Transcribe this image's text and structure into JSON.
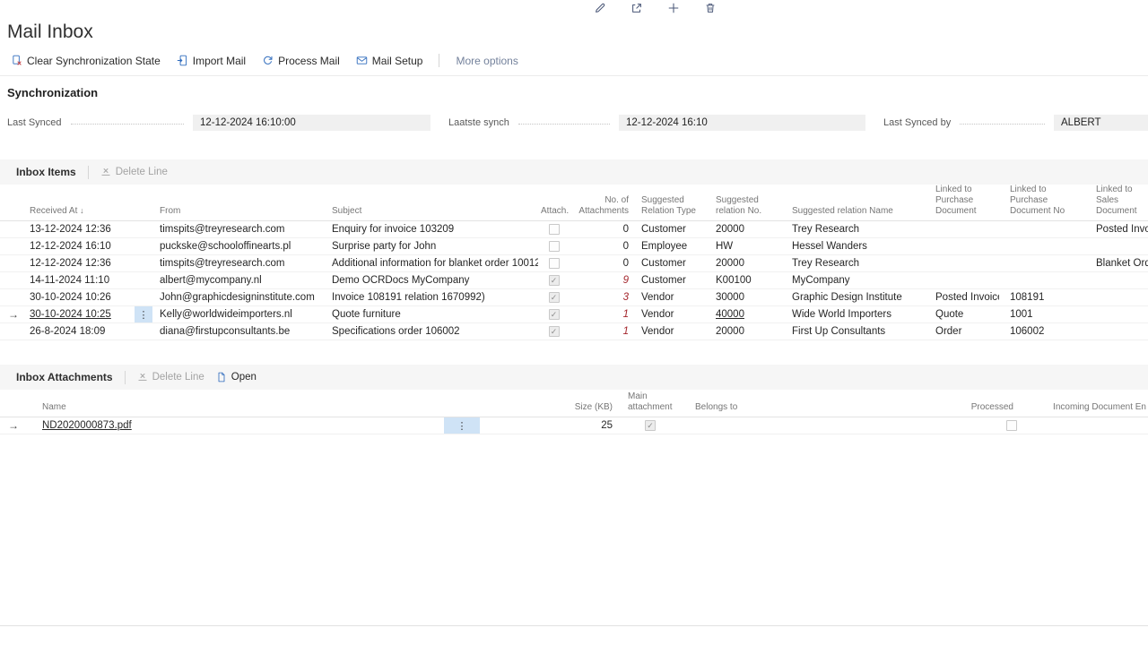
{
  "topbar": {
    "icons": [
      "edit-icon",
      "share-icon",
      "new-icon",
      "delete-icon"
    ]
  },
  "page": {
    "title": "Mail Inbox"
  },
  "action_bar": {
    "clear_sync": "Clear Synchronization State",
    "import_mail": "Import Mail",
    "process_mail": "Process Mail",
    "mail_setup": "Mail Setup",
    "more_options": "More options"
  },
  "synchronization": {
    "heading": "Synchronization",
    "fields": [
      {
        "label": "Last Synced",
        "value": "12-12-2024 16:10:00"
      },
      {
        "label": "Laatste synch",
        "value": "12-12-2024 16:10"
      },
      {
        "label": "Last Synced by",
        "value": "ALBERT"
      }
    ]
  },
  "inbox_items": {
    "caption": "Inbox Items",
    "delete_line_label": "Delete Line",
    "sort_icon": "↓",
    "columns": {
      "received_at": "Received At",
      "from": "From",
      "subject": "Subject",
      "attach": "Attach...",
      "no_of_attachments": "No. of Attachments",
      "relation_type": "Suggested Relation Type",
      "relation_no": "Suggested relation No.",
      "relation_name": "Suggested relation Name",
      "linked_purchase_document": "Linked to Purchase Document",
      "linked_purchase_document_no": "Linked to Purchase Document No",
      "linked_sales_document": "Linked to Sales Document"
    },
    "rows": [
      {
        "received_at": "13-12-2024 12:36",
        "from": "timspits@treyresearch.com",
        "subject": "Enquiry for invoice 103209",
        "attachment": false,
        "no_of_attachments": "0",
        "relation_type": "Customer",
        "relation_no": "20000",
        "relation_no_link": false,
        "relation_name": "Trey Research",
        "linked_purchase_document": "",
        "linked_purchase_document_no": "",
        "linked_sales_document": "Posted Invoice",
        "selected": false
      },
      {
        "received_at": "12-12-2024 16:10",
        "from": "puckske@schooloffinearts.pl",
        "subject": "Surprise party for John",
        "attachment": false,
        "no_of_attachments": "0",
        "relation_type": "Employee",
        "relation_no": "HW",
        "relation_no_link": false,
        "relation_name": "Hessel Wanders",
        "linked_purchase_document": "",
        "linked_purchase_document_no": "",
        "linked_sales_document": "",
        "selected": false
      },
      {
        "received_at": "12-12-2024 12:36",
        "from": "timspits@treyresearch.com",
        "subject": "Additional information for blanket order 10012",
        "attachment": false,
        "no_of_attachments": "0",
        "relation_type": "Customer",
        "relation_no": "20000",
        "relation_no_link": false,
        "relation_name": "Trey Research",
        "linked_purchase_document": "",
        "linked_purchase_document_no": "",
        "linked_sales_document": "Blanket Order",
        "selected": false
      },
      {
        "received_at": "14-11-2024 11:10",
        "from": "albert@mycompany.nl",
        "subject": "Demo OCRDocs MyCompany",
        "attachment": true,
        "no_of_attachments": "9",
        "relation_type": "Customer",
        "relation_no": "K00100",
        "relation_no_link": false,
        "relation_name": "MyCompany",
        "linked_purchase_document": "",
        "linked_purchase_document_no": "",
        "linked_sales_document": "",
        "selected": false
      },
      {
        "received_at": "30-10-2024 10:26",
        "from": "John@graphicdesigninstitute.com",
        "subject": "Invoice 108191 relation 1670992)",
        "attachment": true,
        "no_of_attachments": "3",
        "relation_type": "Vendor",
        "relation_no": "30000",
        "relation_no_link": false,
        "relation_name": "Graphic Design Institute",
        "linked_purchase_document": "Posted Invoice",
        "linked_purchase_document_no": "108191",
        "linked_sales_document": "",
        "selected": false
      },
      {
        "received_at": "30-10-2024 10:25",
        "from": "Kelly@worldwideimporters.nl",
        "subject": "Quote furniture",
        "attachment": true,
        "no_of_attachments": "1",
        "relation_type": "Vendor",
        "relation_no": "40000",
        "relation_no_link": true,
        "relation_name": "Wide World Importers",
        "linked_purchase_document": "Quote",
        "linked_purchase_document_no": "1001",
        "linked_sales_document": "",
        "selected": true
      },
      {
        "received_at": "26-8-2024 18:09",
        "from": "diana@firstupconsultants.be",
        "subject": "Specifications order 106002",
        "attachment": true,
        "no_of_attachments": "1",
        "relation_type": "Vendor",
        "relation_no": "20000",
        "relation_no_link": false,
        "relation_name": "First Up Consultants",
        "linked_purchase_document": "Order",
        "linked_purchase_document_no": "106002",
        "linked_sales_document": "",
        "selected": false
      }
    ]
  },
  "inbox_attachments": {
    "caption": "Inbox Attachments",
    "delete_line_label": "Delete Line",
    "open_label": "Open",
    "columns": {
      "name": "Name",
      "size_kb": "Size (KB)",
      "main_attachment": "Main attachment",
      "belongs_to": "Belongs to",
      "processed": "Processed",
      "incoming_document_entry": "Incoming Document En"
    },
    "rows": [
      {
        "name": "ND2020000873.pdf",
        "size_kb": "25",
        "main_attachment": true,
        "belongs_to": "",
        "processed": false,
        "incoming_document_entry": "",
        "selected": true
      }
    ]
  }
}
